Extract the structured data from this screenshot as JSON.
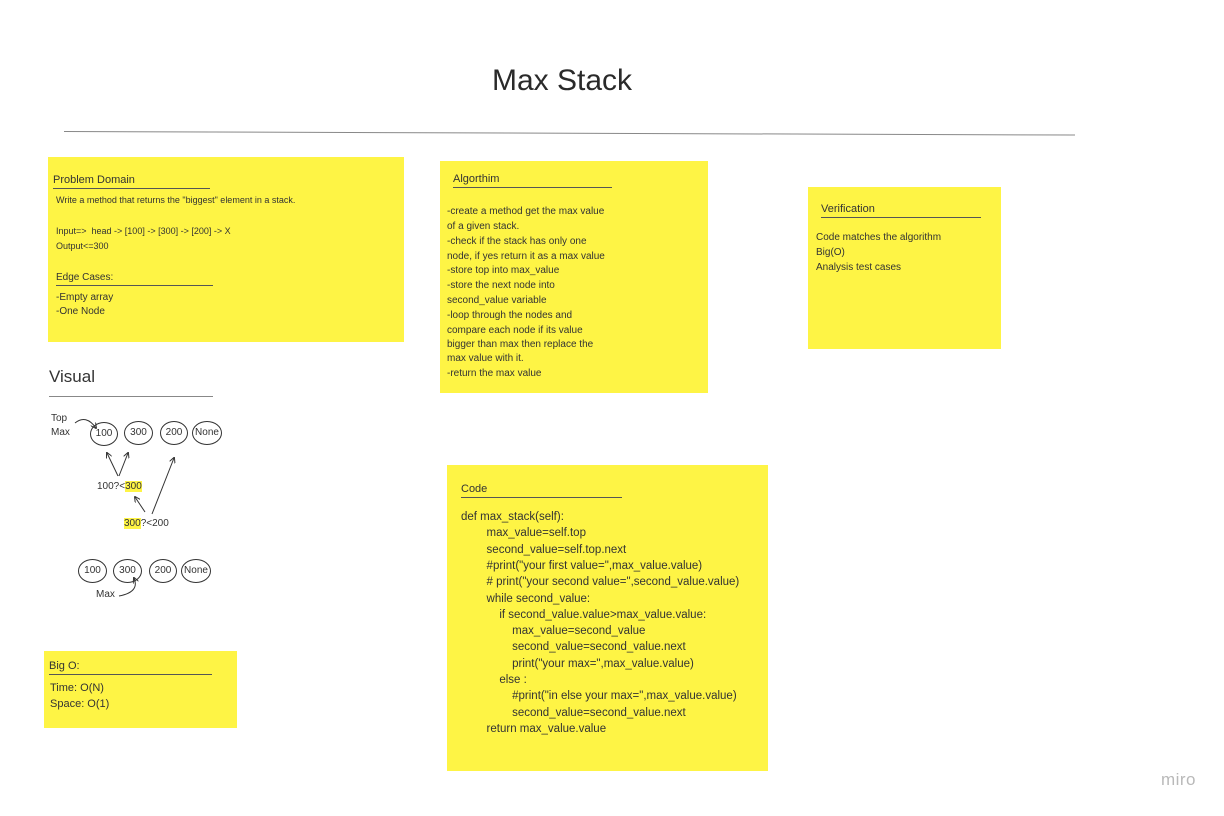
{
  "board": {
    "title": "Max Stack",
    "watermark": "miro"
  },
  "problem": {
    "heading": "Problem Domain",
    "description": "Write a method that returns the \"biggest\" element in a stack.",
    "input": "Input=>  head -> [100] -> [300] -> [200] -> X",
    "output": "Output<=300",
    "edge_heading": "Edge Cases:",
    "edge_cases": [
      "-Empty array",
      "-One Node"
    ]
  },
  "algorithm": {
    "heading": "Algorthim",
    "lines": [
      "-create a method get the max value",
      "of a given stack.",
      "-check if the stack has only one",
      "node, if yes return it as a max value",
      "-store top into max_value",
      "-store the next node into",
      "second_value variable",
      "-loop through the nodes and",
      "compare each node if its value",
      "bigger than max then replace the",
      "max value with it.",
      "-return the max value"
    ]
  },
  "verification": {
    "heading": "Verification",
    "lines": [
      "Code matches the algorithm",
      "Big(O)",
      "Analysis test cases"
    ]
  },
  "visual": {
    "heading": "Visual",
    "top_label": "Top",
    "max_label_top": "Max",
    "row1": [
      "100",
      "300",
      "200",
      "None"
    ],
    "compare1_a": "100?<",
    "compare1_b": "300",
    "compare2_a": "300",
    "compare2_b": "?<200",
    "row2": [
      "100",
      "300",
      "200",
      "None"
    ],
    "max_label_bottom": "Max"
  },
  "bigo": {
    "heading": "Big O:",
    "time": "Time: O(N)",
    "space": "Space: O(1)"
  },
  "code": {
    "heading": "Code",
    "lines": [
      "def max_stack(self):",
      "        max_value=self.top",
      "        second_value=self.top.next",
      "        #print(\"your first value=\",max_value.value)",
      "        # print(\"your second value=\",second_value.value)",
      "        while second_value:",
      "            if second_value.value>max_value.value:",
      "                max_value=second_value",
      "                second_value=second_value.next",
      "                print(\"your max=\",max_value.value)",
      "            else :",
      "                #print(\"in else your max=\",max_value.value)",
      "                second_value=second_value.next",
      "        return max_value.value"
    ]
  }
}
